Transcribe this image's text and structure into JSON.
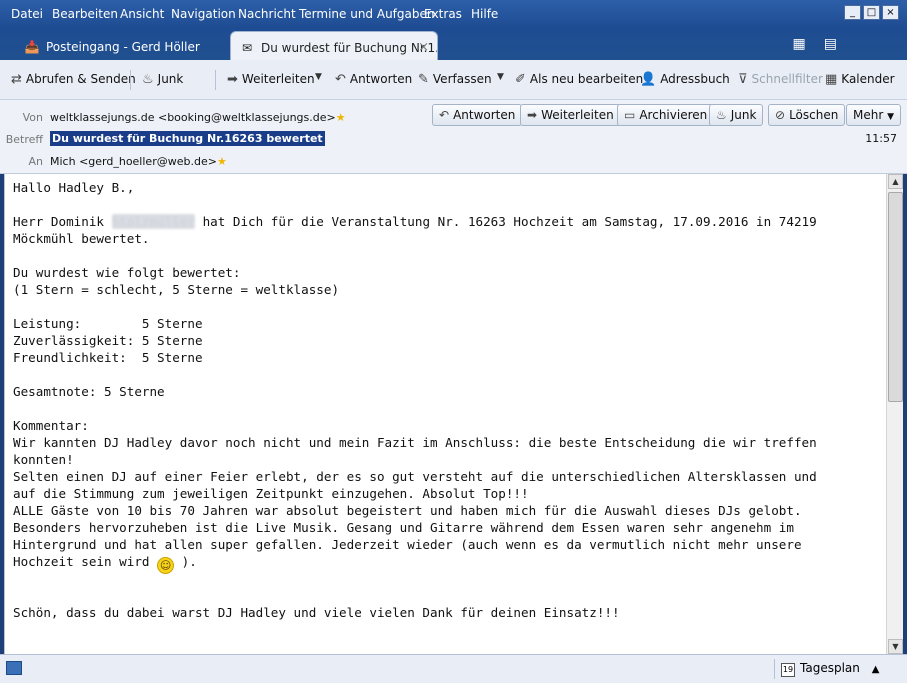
{
  "menu": [
    "Datei",
    "Bearbeiten",
    "Ansicht",
    "Navigation",
    "Nachricht",
    "Termine und Aufgaben",
    "Extras",
    "Hilfe"
  ],
  "window_buttons": [
    "_",
    "□",
    "×"
  ],
  "tabs": {
    "inactive_label": "Posteingang - Gerd Höller",
    "active_label": "Du wurdest für Buchung Nr.1...",
    "close": "×"
  },
  "toolbar": {
    "fetch": "Abrufen & Senden",
    "junk": "Junk",
    "forward": "Weiterleiten",
    "reply": "Antworten",
    "compose": "Verfassen",
    "edit_new": "Als neu bearbeiten",
    "addressbook": "Adressbuch",
    "quickfilter": "Schnellfilter",
    "calendar": "Kalender"
  },
  "header": {
    "from_label": "Von",
    "from_value": "weltklassejungs.de <booking@weltklassejungs.de>",
    "subject_label": "Betreff",
    "subject_value": "Du wurdest für Buchung Nr.16263 bewertet",
    "to_label": "An",
    "to_value": "Mich <gerd_hoeller@web.de>",
    "time": "11:57",
    "buttons": {
      "reply": "Antworten",
      "forward": "Weiterleiten",
      "archive": "Archivieren",
      "junk": "Junk",
      "delete": "Löschen",
      "more": "Mehr"
    }
  },
  "body": {
    "greeting": "Hallo Hadley B.,",
    "l2a": "Herr Dominik ",
    "l2_blur": "Stolzmüller",
    "l2b": " hat Dich für die Veranstaltung Nr. 16263 Hochzeit am Samstag, 17.09.2016 in 74219",
    "l3": "Möckmühl bewertet.",
    "l5": "Du wurdest wie folgt bewertet:",
    "l6": "(1 Stern = schlecht, 5 Sterne = weltklasse)",
    "l8": "Leistung:        5 Sterne",
    "l9": "Zuverlässigkeit: 5 Sterne",
    "l10": "Freundlichkeit:  5 Sterne",
    "l12": "Gesamtnote: 5 Sterne",
    "l14": "Kommentar:",
    "l15": "Wir kannten DJ Hadley davor noch nicht und mein Fazit im Anschluss: die beste Entscheidung die wir treffen",
    "l16": "konnten!",
    "l17": "Selten einen DJ auf einer Feier erlebt, der es so gut versteht auf die unterschiedlichen Altersklassen und",
    "l18": "auf die Stimmung zum jeweiligen Zeitpunkt einzugehen. Absolut Top!!!",
    "l19": "ALLE Gäste von 10 bis 70 Jahren war absolut begeistert und haben mich für die Auswahl dieses DJs gelobt.",
    "l20": "Besonders hervorzuheben ist die Live Musik. Gesang und Gitarre während dem Essen waren sehr angenehm im",
    "l21": "Hintergrund und hat allen super gefallen. Jederzeit wieder (auch wenn es da vermutlich nicht mehr unsere",
    "l22a": "Hochzeit sein wird ",
    "l22b": " ).",
    "l25": "Schön, dass du dabei warst DJ Hadley und viele vielen Dank für deinen Einsatz!!!"
  },
  "statusbar": {
    "tagesplan": "Tagesplan",
    "cal_day": "19"
  }
}
